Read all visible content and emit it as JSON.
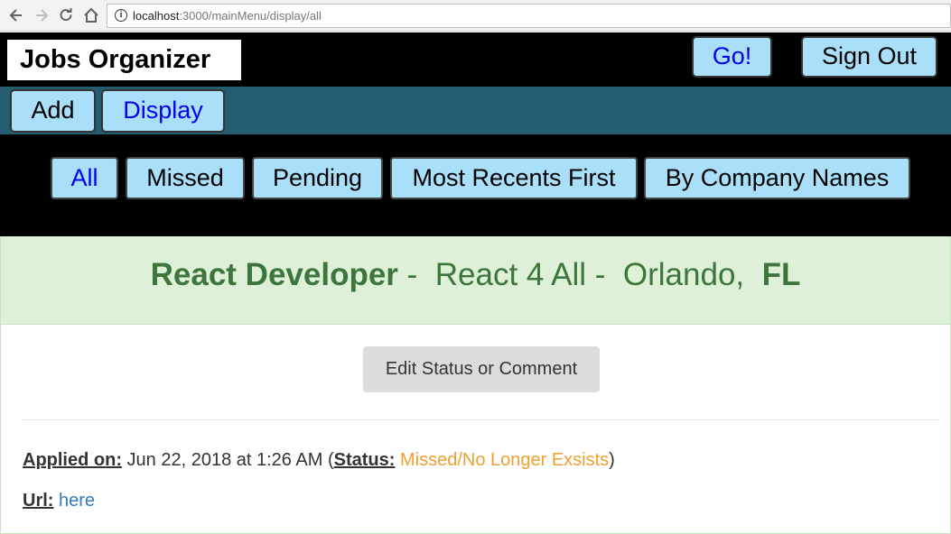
{
  "browser": {
    "url_host": "localhost",
    "url_path": ":3000/mainMenu/display/all"
  },
  "header": {
    "title": "Jobs Organizer",
    "go_label": "Go!",
    "signout_label": "Sign Out"
  },
  "subnav": {
    "add_label": "Add",
    "display_label": "Display"
  },
  "filters": [
    {
      "label": "All",
      "active": true
    },
    {
      "label": "Missed",
      "active": false
    },
    {
      "label": "Pending",
      "active": false
    },
    {
      "label": "Most Recents First",
      "active": false
    },
    {
      "label": "By Company Names",
      "active": false
    }
  ],
  "job": {
    "title": "React Developer",
    "company": "React 4 All",
    "city": "Orlando,",
    "state": "FL",
    "edit_label": "Edit Status or Comment",
    "applied_label": "Applied on:",
    "applied_value": "Jun 22, 2018 at 1:26 AM",
    "status_label": "Status:",
    "status_value": "Missed/No Longer Exsists",
    "url_label": "Url:",
    "url_link": "here"
  },
  "colors": {
    "header_bg": "#000000",
    "subnav_bg": "#245d70",
    "button_bg": "#aadff9",
    "active_text": "#0000ee",
    "panel_bg": "#dff0d8",
    "panel_text": "#3c763d",
    "status_text": "#f0a030",
    "link_text": "#337ab7"
  }
}
